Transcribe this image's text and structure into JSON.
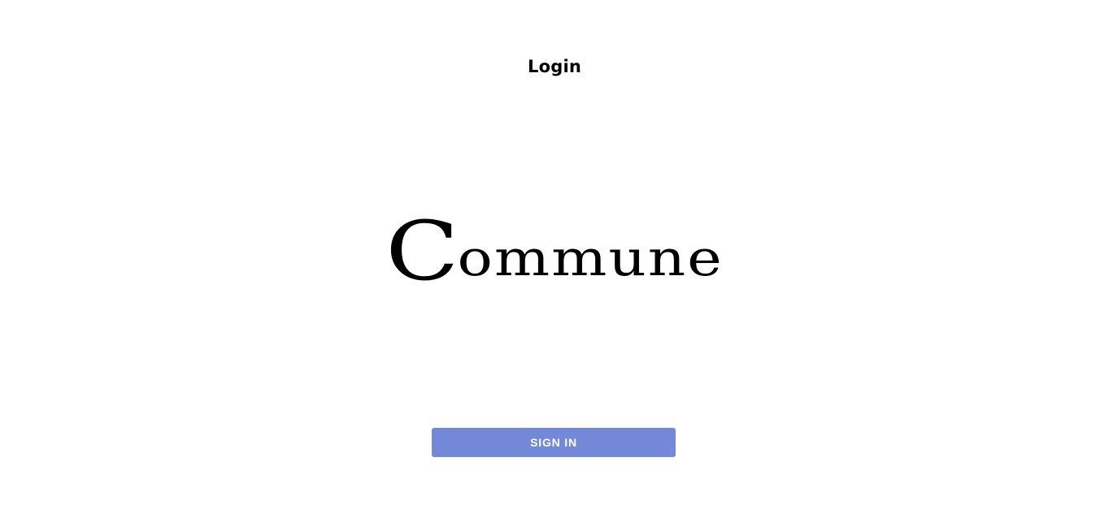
{
  "page": {
    "title": "Login"
  },
  "logo": {
    "text_initial": "C",
    "text_rest": "ommune"
  },
  "actions": {
    "sign_in_label": "SIGN IN"
  },
  "colors": {
    "background": "#ffffff",
    "button": "#7389d8",
    "button_text": "#ffffff",
    "text": "#000000"
  }
}
